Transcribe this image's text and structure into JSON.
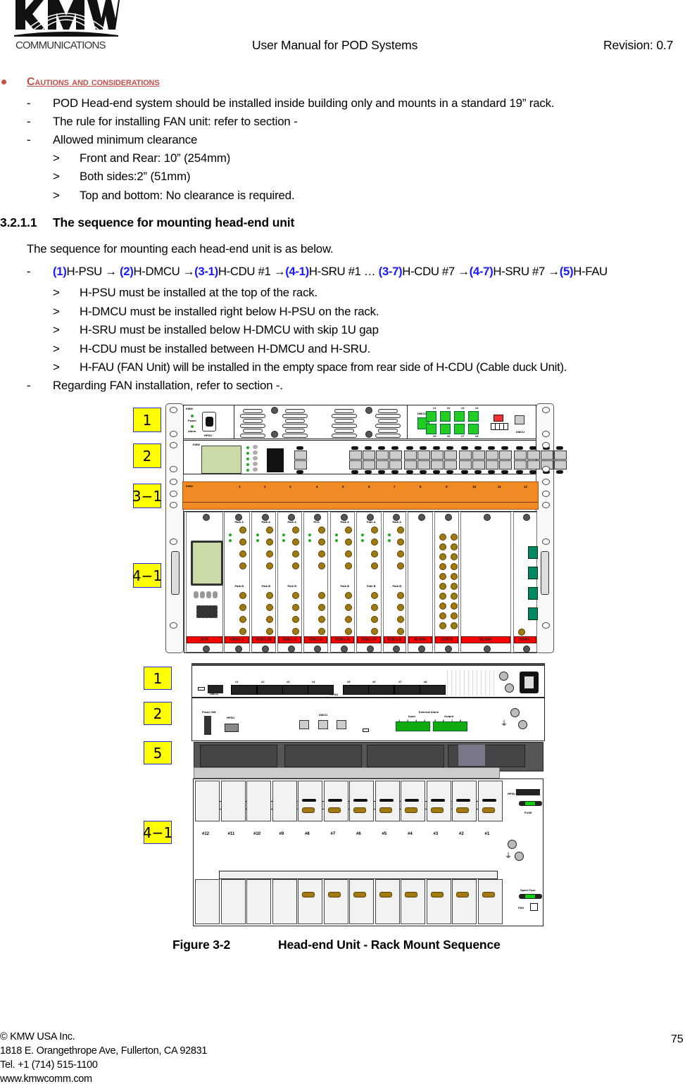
{
  "header": {
    "logo_text": "KMW COMMUNICATIONS",
    "title": "User Manual for POD Systems",
    "revision": "Revision: 0.7"
  },
  "cautions": {
    "heading": "Cautions and considerations",
    "items": [
      "POD Head-end system should be installed inside building only and mounts in a standard 19” rack.",
      "The rule for installing FAN unit: refer to section -",
      "Allowed minimum clearance"
    ],
    "clearance": [
      "Front and Rear: 10” (254mm)",
      "Both sides:2” (51mm)",
      "Top and bottom: No clearance is required."
    ]
  },
  "section": {
    "number": "3.2.1.1",
    "title": "The sequence for mounting head-end unit",
    "intro": "The sequence for mounting each head-end unit is as below.",
    "sequence": [
      {
        "step": "(1)",
        "text": "H-PSU → "
      },
      {
        "step": "(2)",
        "text": "H-DMCU →"
      },
      {
        "step": "(3-1)",
        "text": "H-CDU #1 →"
      },
      {
        "step": "(4-1)",
        "text": "H-SRU #1 … "
      },
      {
        "step": "(3-7)",
        "text": "H-CDU #7 →"
      },
      {
        "step": "(4-7)",
        "text": "H-SRU #7 →"
      },
      {
        "step": "(5)",
        "text": "H-FAU"
      }
    ],
    "rules": [
      "H-PSU must be installed at the top of the rack.",
      "H-DMCU must be installed right below H-PSU on the rack.",
      "H-SRU must be installed below H-DMCU with skip 1U gap",
      "H-CDU must be installed between H-DMCU and H-SRU.",
      "H-FAU (FAN Unit) will be installed in the empty space from rear side of H-CDU (Cable duck Unit)."
    ],
    "fan_note": "Regarding FAN installation, refer to section -."
  },
  "figure": {
    "front_labels": [
      "1",
      "2",
      "3−1",
      "4−1"
    ],
    "rear_labels": [
      "1",
      "2",
      "5",
      "4−1"
    ],
    "front": {
      "psu_label": "HPSU",
      "psu_leds": [
        "Power",
        "Alarm"
      ],
      "dmcu_label": "DMCU",
      "dmcu_ports_top": [
        "#1",
        "#2",
        "#3",
        "#4"
      ],
      "dmcu_ports_bottom": [
        "#5",
        "#6",
        "#7",
        "#8"
      ],
      "dmcu_right_label": "DMCU",
      "brand": "KMW",
      "cdu_numbers": [
        "1",
        "2",
        "3",
        "4",
        "5",
        "6",
        "7",
        "8",
        "9",
        "10",
        "11",
        "12"
      ],
      "cards": [
        "SCM",
        "FEM-L-7",
        "FEM-L-58",
        "FEM-L-C",
        "FEM-L-P",
        "FEM-L-A",
        "FEM-L-W",
        "FEM-L-B",
        "BLANK",
        "COM-8",
        "BLANK",
        "HCM-L"
      ],
      "path_a": "Path A",
      "path_b": "Path B",
      "pcs": "PCS"
    },
    "rear": {
      "dmcu_conn": "DMCU",
      "hpsu_conn": "HPSU",
      "conn_ports": [
        "#1",
        "#2",
        "#3",
        "#4",
        "#5",
        "#6",
        "#7",
        "#8"
      ],
      "power_sw": "Power SW",
      "hpsu": "HPSU",
      "dmcu": "DMCU",
      "external_alarm": "External Alarm",
      "input": "Input",
      "output": "Output",
      "alarm_numbers": [
        "1",
        "2",
        "3",
        "4",
        "5",
        "6",
        "7",
        "8"
      ],
      "slots": [
        "#12",
        "#11",
        "#10",
        "#9",
        "#8",
        "#7",
        "#6",
        "#5",
        "#4",
        "#3",
        "#2",
        "#1"
      ],
      "fuse": "FUSE",
      "spare_fuse": "Spare Fuse",
      "fan": "FAN",
      "hpsu_right": "HPSU"
    },
    "caption_number": "Figure 3-2",
    "caption_title": "Head-end Unit - Rack Mount Sequence"
  },
  "footer": {
    "company": "© KMW USA Inc.",
    "address": "1818 E. Orangethrope Ave, Fullerton, CA 92831",
    "tel": "Tel. +1 (714) 515-1100",
    "web": "www.kmwcomm.com",
    "page": "75"
  },
  "colors": {
    "caution_heading": "#c0504d",
    "step_blue": "#1a1aff",
    "label_yellow": "#ffff00",
    "cdu_orange": "#f08a24",
    "card_label_red": "#ff0000"
  }
}
